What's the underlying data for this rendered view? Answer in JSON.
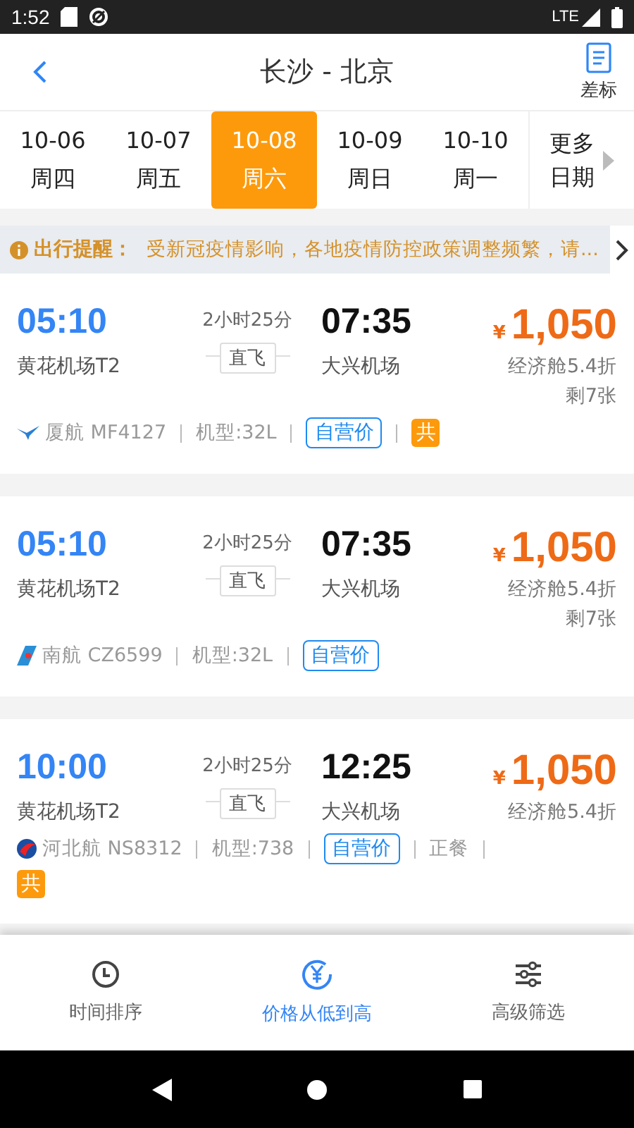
{
  "status_bar": {
    "time": "1:52",
    "network": "LTE"
  },
  "header": {
    "title": "长沙 - 北京",
    "right_action": "差标"
  },
  "dates": [
    {
      "date": "10-06",
      "weekday": "周四",
      "selected": false
    },
    {
      "date": "10-07",
      "weekday": "周五",
      "selected": false
    },
    {
      "date": "10-08",
      "weekday": "周六",
      "selected": true
    },
    {
      "date": "10-09",
      "weekday": "周日",
      "selected": false
    },
    {
      "date": "10-10",
      "weekday": "周一",
      "selected": false
    }
  ],
  "more_dates": "更多日期",
  "notice": {
    "label": "出行提醒：",
    "text": "受新冠疫情影响，各地疫情防控政策调整频繁，请..."
  },
  "flights": [
    {
      "depart": "05:10",
      "duration": "2小时25分",
      "arrive": "07:35",
      "from": "黄花机场T2",
      "stop": "直飞",
      "to": "大兴机场",
      "currency": "¥",
      "price": "1,050",
      "cabin": "经济舱5.4折",
      "remaining": "剩7张",
      "info": [
        {
          "kind": "text",
          "text": "厦航 MF4127"
        },
        {
          "kind": "text",
          "text": "机型:32L"
        },
        {
          "kind": "tag",
          "text": "自营价"
        },
        {
          "kind": "shared",
          "text": "共"
        }
      ]
    },
    {
      "depart": "05:10",
      "duration": "2小时25分",
      "arrive": "07:35",
      "from": "黄花机场T2",
      "stop": "直飞",
      "to": "大兴机场",
      "currency": "¥",
      "price": "1,050",
      "cabin": "经济舱5.4折",
      "remaining": "剩7张",
      "info": [
        {
          "kind": "text",
          "text": "南航 CZ6599"
        },
        {
          "kind": "text",
          "text": "机型:32L"
        },
        {
          "kind": "tag",
          "text": "自营价"
        }
      ]
    },
    {
      "depart": "10:00",
      "duration": "2小时25分",
      "arrive": "12:25",
      "from": "黄花机场T2",
      "stop": "直飞",
      "to": "大兴机场",
      "currency": "¥",
      "price": "1,050",
      "cabin": "经济舱5.4折",
      "info": [
        {
          "kind": "text",
          "text": "河北航 NS8312"
        },
        {
          "kind": "text",
          "text": "机型:738"
        },
        {
          "kind": "tag",
          "text": "自营价"
        },
        {
          "kind": "text",
          "text": "正餐"
        },
        {
          "kind": "shared",
          "text": "共"
        }
      ]
    }
  ],
  "bottom_tabs": [
    {
      "label": "时间排序",
      "kind": "clock",
      "selected": false
    },
    {
      "label": "价格从低到高",
      "kind": "price",
      "selected": true
    },
    {
      "label": "高级筛选",
      "kind": "filter",
      "selected": false
    }
  ]
}
